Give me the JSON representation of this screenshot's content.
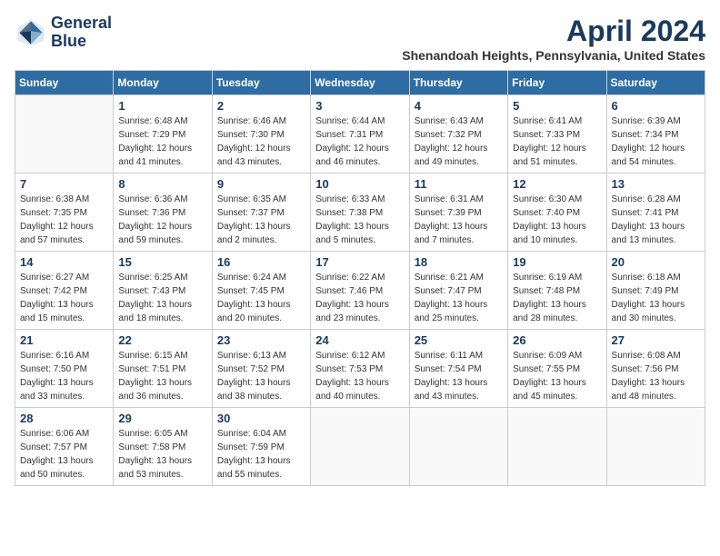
{
  "logo": {
    "line1": "General",
    "line2": "Blue"
  },
  "title": "April 2024",
  "location": "Shenandoah Heights, Pennsylvania, United States",
  "weekdays": [
    "Sunday",
    "Monday",
    "Tuesday",
    "Wednesday",
    "Thursday",
    "Friday",
    "Saturday"
  ],
  "weeks": [
    [
      {
        "day": "",
        "info": ""
      },
      {
        "day": "1",
        "info": "Sunrise: 6:48 AM\nSunset: 7:29 PM\nDaylight: 12 hours\nand 41 minutes."
      },
      {
        "day": "2",
        "info": "Sunrise: 6:46 AM\nSunset: 7:30 PM\nDaylight: 12 hours\nand 43 minutes."
      },
      {
        "day": "3",
        "info": "Sunrise: 6:44 AM\nSunset: 7:31 PM\nDaylight: 12 hours\nand 46 minutes."
      },
      {
        "day": "4",
        "info": "Sunrise: 6:43 AM\nSunset: 7:32 PM\nDaylight: 12 hours\nand 49 minutes."
      },
      {
        "day": "5",
        "info": "Sunrise: 6:41 AM\nSunset: 7:33 PM\nDaylight: 12 hours\nand 51 minutes."
      },
      {
        "day": "6",
        "info": "Sunrise: 6:39 AM\nSunset: 7:34 PM\nDaylight: 12 hours\nand 54 minutes."
      }
    ],
    [
      {
        "day": "7",
        "info": "Sunrise: 6:38 AM\nSunset: 7:35 PM\nDaylight: 12 hours\nand 57 minutes."
      },
      {
        "day": "8",
        "info": "Sunrise: 6:36 AM\nSunset: 7:36 PM\nDaylight: 12 hours\nand 59 minutes."
      },
      {
        "day": "9",
        "info": "Sunrise: 6:35 AM\nSunset: 7:37 PM\nDaylight: 13 hours\nand 2 minutes."
      },
      {
        "day": "10",
        "info": "Sunrise: 6:33 AM\nSunset: 7:38 PM\nDaylight: 13 hours\nand 5 minutes."
      },
      {
        "day": "11",
        "info": "Sunrise: 6:31 AM\nSunset: 7:39 PM\nDaylight: 13 hours\nand 7 minutes."
      },
      {
        "day": "12",
        "info": "Sunrise: 6:30 AM\nSunset: 7:40 PM\nDaylight: 13 hours\nand 10 minutes."
      },
      {
        "day": "13",
        "info": "Sunrise: 6:28 AM\nSunset: 7:41 PM\nDaylight: 13 hours\nand 13 minutes."
      }
    ],
    [
      {
        "day": "14",
        "info": "Sunrise: 6:27 AM\nSunset: 7:42 PM\nDaylight: 13 hours\nand 15 minutes."
      },
      {
        "day": "15",
        "info": "Sunrise: 6:25 AM\nSunset: 7:43 PM\nDaylight: 13 hours\nand 18 minutes."
      },
      {
        "day": "16",
        "info": "Sunrise: 6:24 AM\nSunset: 7:45 PM\nDaylight: 13 hours\nand 20 minutes."
      },
      {
        "day": "17",
        "info": "Sunrise: 6:22 AM\nSunset: 7:46 PM\nDaylight: 13 hours\nand 23 minutes."
      },
      {
        "day": "18",
        "info": "Sunrise: 6:21 AM\nSunset: 7:47 PM\nDaylight: 13 hours\nand 25 minutes."
      },
      {
        "day": "19",
        "info": "Sunrise: 6:19 AM\nSunset: 7:48 PM\nDaylight: 13 hours\nand 28 minutes."
      },
      {
        "day": "20",
        "info": "Sunrise: 6:18 AM\nSunset: 7:49 PM\nDaylight: 13 hours\nand 30 minutes."
      }
    ],
    [
      {
        "day": "21",
        "info": "Sunrise: 6:16 AM\nSunset: 7:50 PM\nDaylight: 13 hours\nand 33 minutes."
      },
      {
        "day": "22",
        "info": "Sunrise: 6:15 AM\nSunset: 7:51 PM\nDaylight: 13 hours\nand 36 minutes."
      },
      {
        "day": "23",
        "info": "Sunrise: 6:13 AM\nSunset: 7:52 PM\nDaylight: 13 hours\nand 38 minutes."
      },
      {
        "day": "24",
        "info": "Sunrise: 6:12 AM\nSunset: 7:53 PM\nDaylight: 13 hours\nand 40 minutes."
      },
      {
        "day": "25",
        "info": "Sunrise: 6:11 AM\nSunset: 7:54 PM\nDaylight: 13 hours\nand 43 minutes."
      },
      {
        "day": "26",
        "info": "Sunrise: 6:09 AM\nSunset: 7:55 PM\nDaylight: 13 hours\nand 45 minutes."
      },
      {
        "day": "27",
        "info": "Sunrise: 6:08 AM\nSunset: 7:56 PM\nDaylight: 13 hours\nand 48 minutes."
      }
    ],
    [
      {
        "day": "28",
        "info": "Sunrise: 6:06 AM\nSunset: 7:57 PM\nDaylight: 13 hours\nand 50 minutes."
      },
      {
        "day": "29",
        "info": "Sunrise: 6:05 AM\nSunset: 7:58 PM\nDaylight: 13 hours\nand 53 minutes."
      },
      {
        "day": "30",
        "info": "Sunrise: 6:04 AM\nSunset: 7:59 PM\nDaylight: 13 hours\nand 55 minutes."
      },
      {
        "day": "",
        "info": ""
      },
      {
        "day": "",
        "info": ""
      },
      {
        "day": "",
        "info": ""
      },
      {
        "day": "",
        "info": ""
      }
    ]
  ]
}
